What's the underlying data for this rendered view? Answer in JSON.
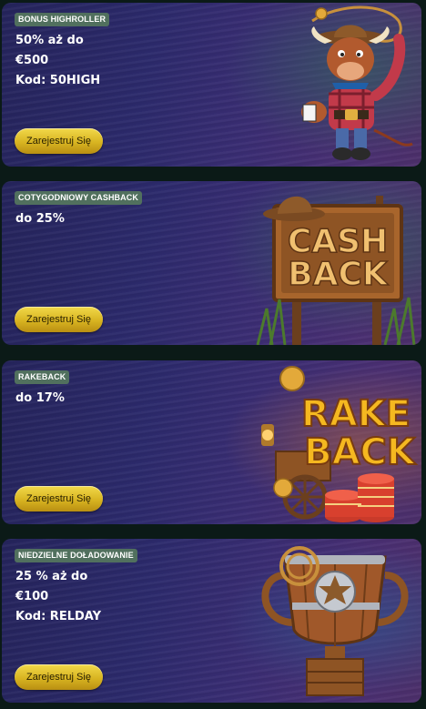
{
  "promotions": [
    {
      "badge": "BONUS HIGHROLLER",
      "lines": [
        "50% aż do",
        "€500",
        "Kod: 50HIGH"
      ],
      "cta": "Zarejestruj Się",
      "illustration": "bull-cowboy-mascot"
    },
    {
      "badge": "COTYGODNIOWY CASHBACK",
      "lines": [
        "do 25%"
      ],
      "cta": "Zarejestruj Się",
      "illustration": "cashback-wooden-sign",
      "sign_words": [
        "CASH",
        "BACK"
      ]
    },
    {
      "badge": "RAKEBACK",
      "lines": [
        "do 17%"
      ],
      "cta": "Zarejestruj Się",
      "illustration": "rakeback-chips-cart",
      "sign_words": [
        "RAKE",
        "BACK"
      ]
    },
    {
      "badge": "NIEDZIELNE DOŁADOWANIE",
      "lines": [
        "25 % aż do",
        "€100",
        "Kod: RELDAY"
      ],
      "cta": "Zarejestruj Się",
      "illustration": "trophy-sheriff-star"
    }
  ],
  "colors": {
    "badge_bg": "#51705e",
    "button_gold": "#d8b421",
    "card_purple": "#2c2a6c",
    "page_bg": "#0b1a17"
  }
}
